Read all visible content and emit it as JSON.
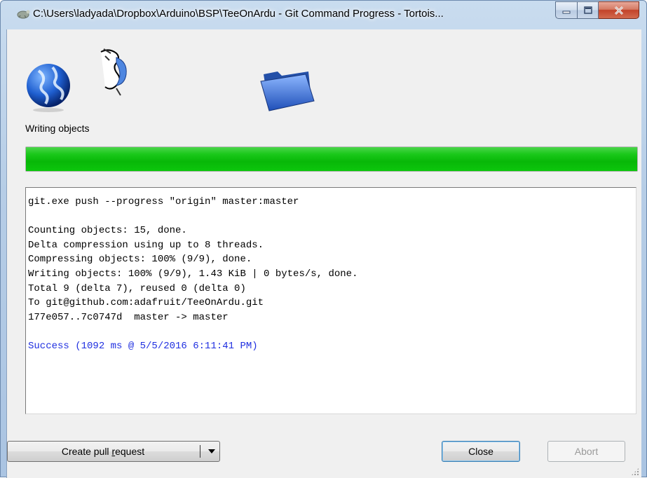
{
  "window": {
    "title": "C:\\Users\\ladyada\\Dropbox\\Arduino\\BSP\\TeeOnArdu - Git Command Progress - Tortois...",
    "caption_buttons": {
      "minimize": "minimize-icon",
      "maximize": "maximize-icon",
      "close": "close-icon"
    }
  },
  "animation": {
    "icons": [
      "globe-icon",
      "paper-icon",
      "folder-icon"
    ]
  },
  "status": {
    "label": "Writing objects",
    "progress_percent": 100
  },
  "log": {
    "lines": [
      {
        "text": "git.exe push --progress \"origin\" master:master",
        "kind": "normal"
      },
      {
        "text": "",
        "kind": "blank"
      },
      {
        "text": "Counting objects: 15, done.",
        "kind": "normal"
      },
      {
        "text": "Delta compression using up to 8 threads.",
        "kind": "normal"
      },
      {
        "text": "Compressing objects: 100% (9/9), done.",
        "kind": "normal"
      },
      {
        "text": "Writing objects: 100% (9/9), 1.43 KiB | 0 bytes/s, done.",
        "kind": "normal"
      },
      {
        "text": "Total 9 (delta 7), reused 0 (delta 0)",
        "kind": "normal"
      },
      {
        "text": "To git@github.com:adafruit/TeeOnArdu.git",
        "kind": "normal"
      },
      {
        "text": "177e057..7c0747d  master -> master",
        "kind": "normal"
      },
      {
        "text": "",
        "kind": "blank"
      },
      {
        "text": "Success (1092 ms @ 5/5/2016 6:11:41 PM)",
        "kind": "success"
      }
    ]
  },
  "buttons": {
    "create_pull_request": "Create pull request",
    "close": "Close",
    "abort": "Abort"
  },
  "colors": {
    "progress": "#08b808",
    "success_text": "#1f2fe0"
  }
}
